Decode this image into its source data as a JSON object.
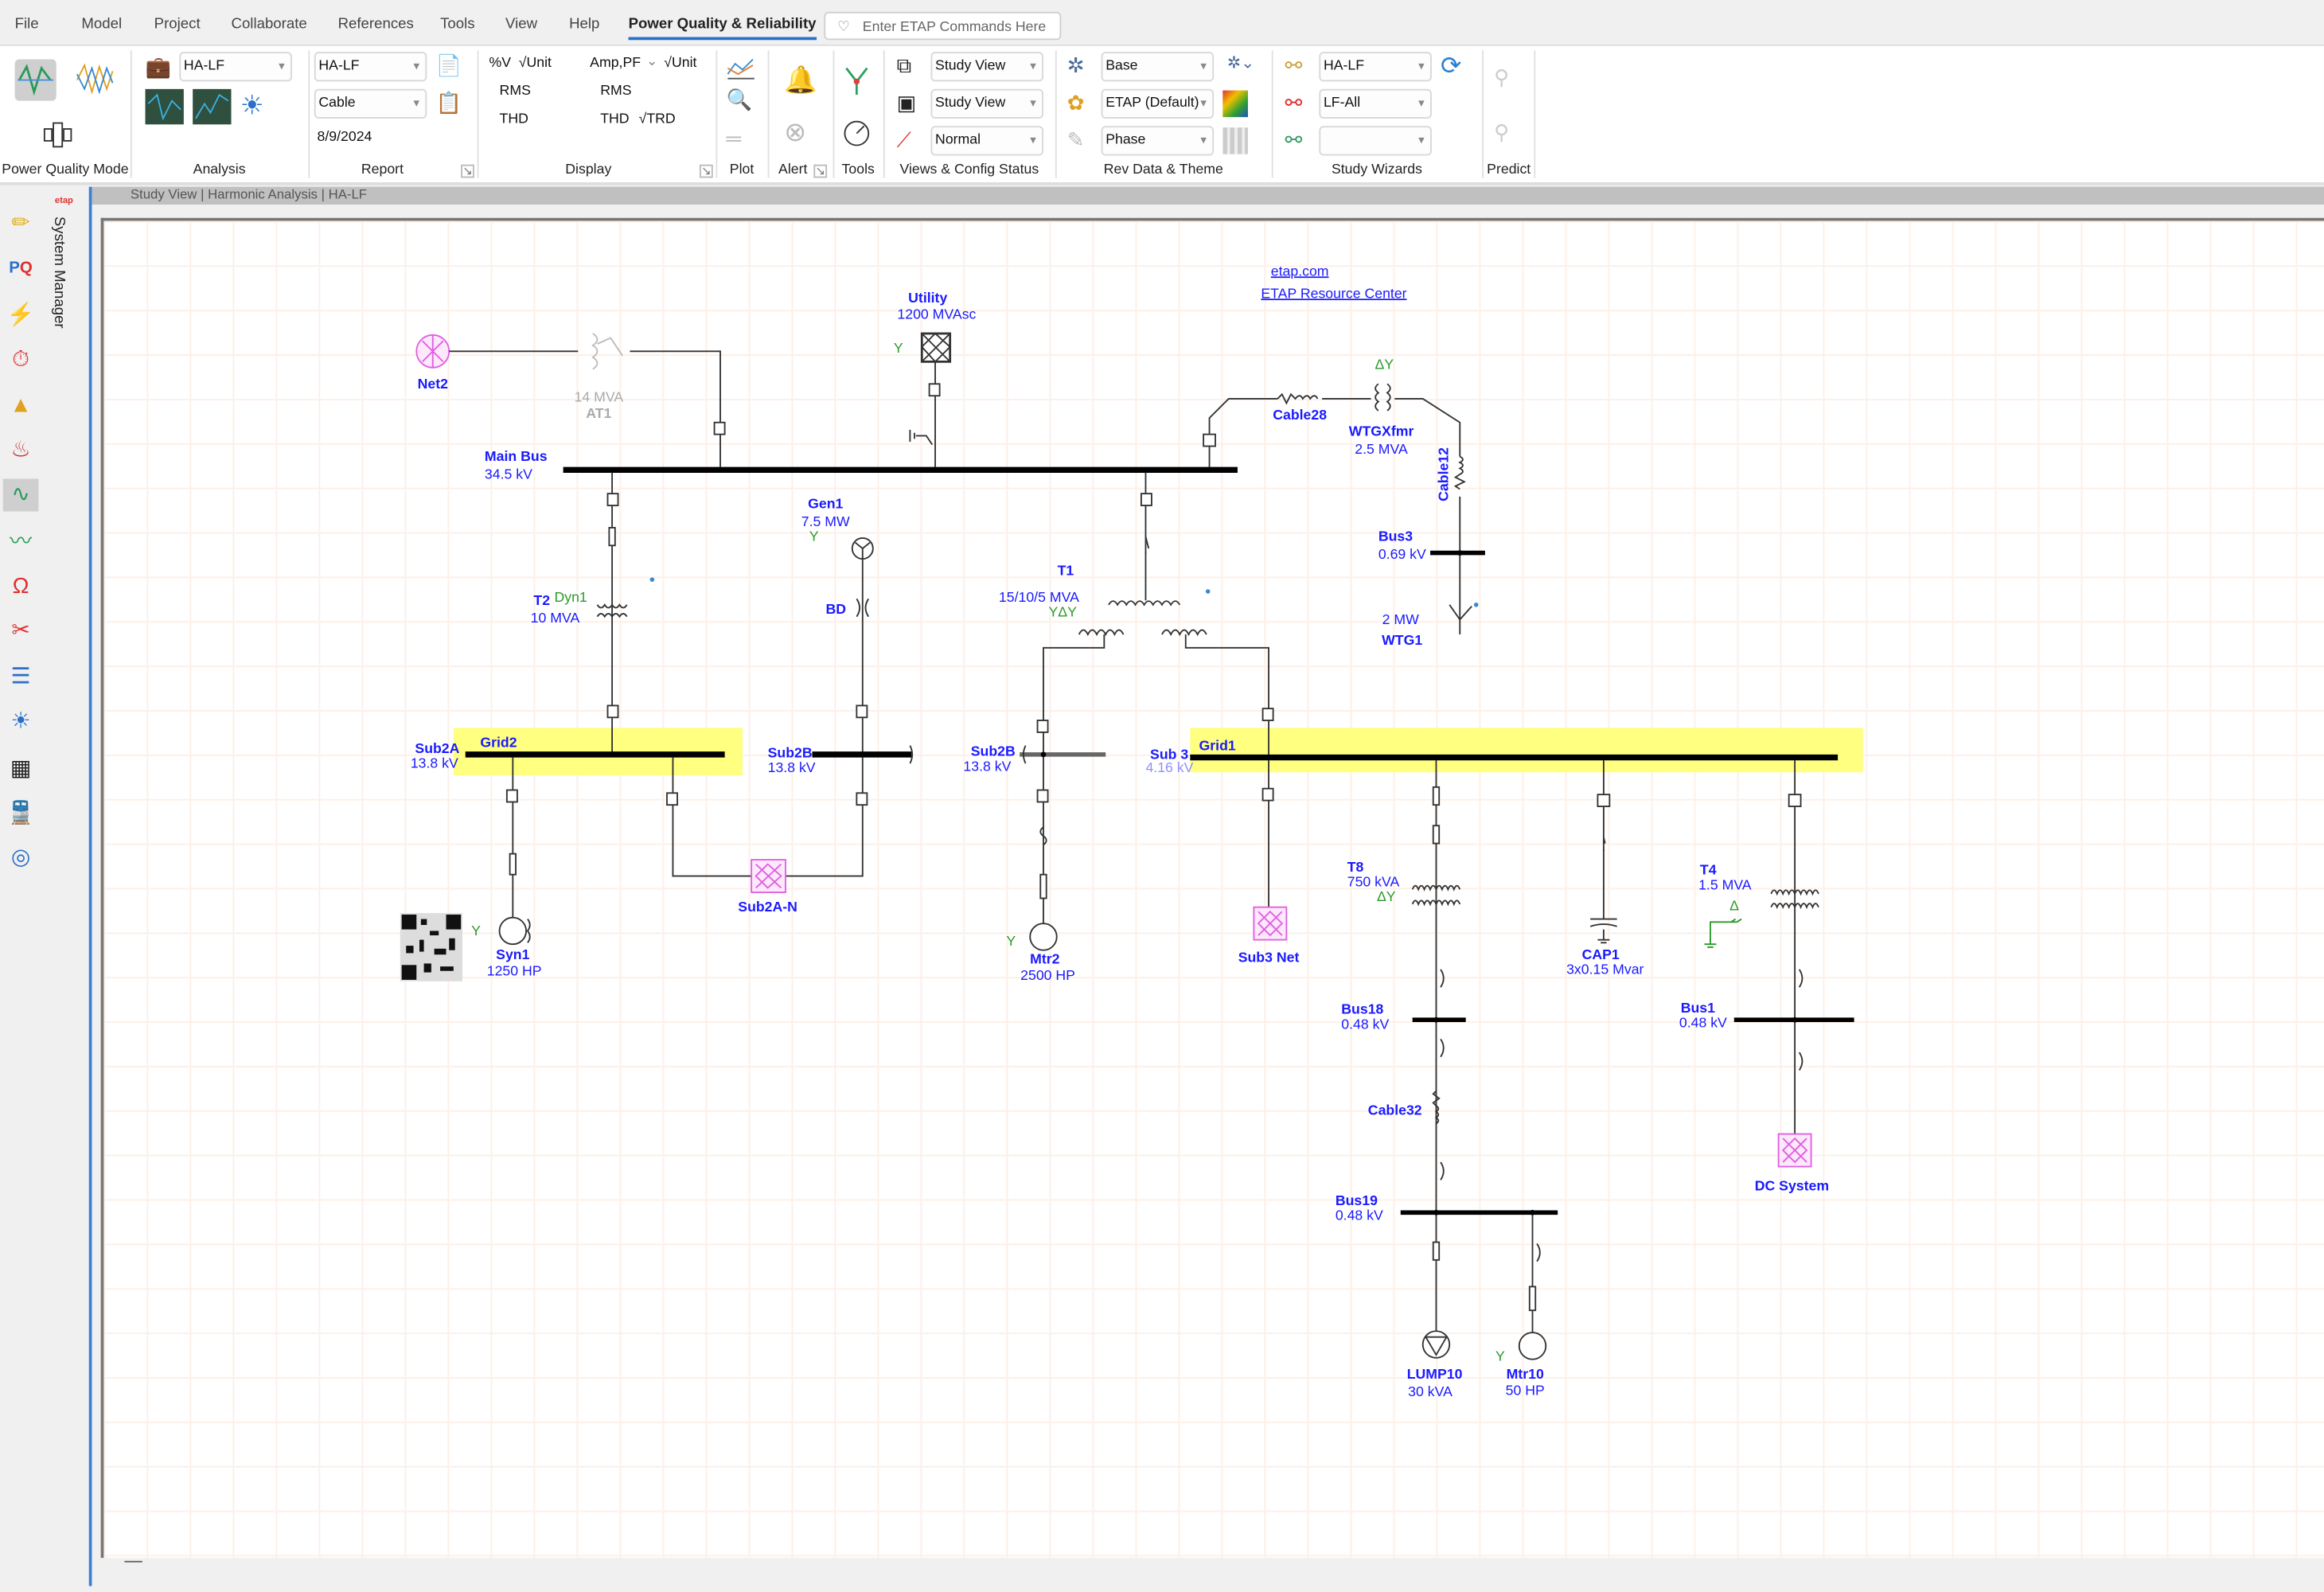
{
  "menu": {
    "items": [
      "File",
      "Model",
      "Project",
      "Collaborate",
      "References",
      "Tools",
      "View",
      "Help",
      "Power Quality & Reliability"
    ],
    "active": "Power Quality & Reliability"
  },
  "search": {
    "placeholder": "Enter ETAP Commands Here"
  },
  "ribbon": {
    "groups": {
      "pq_mode": "Power Quality Mode",
      "analysis": "Analysis",
      "report": "Report",
      "display": "Display",
      "plot": "Plot",
      "alert": "Alert",
      "tools": "Tools",
      "views": "Views & Config Status",
      "revdata": "Rev Data & Theme",
      "wizards": "Study Wizards",
      "predict": "Predict"
    },
    "analysis": {
      "study_case": "HA-LF"
    },
    "report": {
      "output": "HA-LF",
      "type": "Cable",
      "date": "8/9/2024"
    },
    "display": {
      "v": "%V",
      "v_unit": "√Unit",
      "rms1": "RMS",
      "thd1": "THD",
      "amp": "Amp,PF",
      "amp_unit": "√Unit",
      "rms2": "RMS",
      "thd2": "THD",
      "trd": "√TRD"
    },
    "views": {
      "presentation": "Study View",
      "config_view": "Study View",
      "config": "Normal"
    },
    "revdata": {
      "revision": "Base",
      "theme": "ETAP (Default)",
      "phase": "Phase"
    },
    "wizards": {
      "study": "HA-LF",
      "scenario": "LF-All",
      "third": ""
    }
  },
  "window": {
    "title": "Study View | Harmonic Analysis | HA-LF"
  },
  "side_tab": {
    "label": "System Manager"
  },
  "diagram": {
    "links": {
      "etap": "etap.com",
      "resource": "ETAP Resource Center"
    },
    "net2": "Net2",
    "at1": {
      "rating": "14 MVA",
      "name": "AT1"
    },
    "utility": {
      "name": "Utility",
      "rating": "1200 MVAsc"
    },
    "main_bus": {
      "name": "Main Bus",
      "kv": "34.5 kV"
    },
    "cable28": "Cable28",
    "wtgxfmr": {
      "conn": "ΔY",
      "name": "WTGXfmr",
      "rating": "2.5 MVA"
    },
    "cable12": "Cable12",
    "bus3": {
      "name": "Bus3",
      "kv": "0.69 kV"
    },
    "wtg1": {
      "rating": "2 MW",
      "name": "WTG1"
    },
    "gen1": {
      "name": "Gen1",
      "rating": "7.5 MW"
    },
    "t1": {
      "name": "T1",
      "rating": "15/10/5 MVA",
      "conn": "YΔY"
    },
    "t2": {
      "name": "T2",
      "conn": "Dyn1",
      "rating": "10 MVA"
    },
    "bd": "BD",
    "grid2": "Grid2",
    "sub2a": {
      "name": "Sub2A",
      "kv": "13.8 kV"
    },
    "sub2b": {
      "name": "Sub2B",
      "kv": "13.8 kV"
    },
    "sub2b_r": {
      "name": "Sub2B",
      "kv": "13.8 kV"
    },
    "sub3": {
      "name": "Sub 3",
      "kv": "4.16 kV"
    },
    "grid1": "Grid1",
    "sub2an": "Sub2A-N",
    "syn1": {
      "conn": "Y",
      "name": "Syn1",
      "rating": "1250 HP"
    },
    "mtr2": {
      "conn": "Y",
      "name": "Mtr2",
      "rating": "2500 HP"
    },
    "sub3net": "Sub3 Net",
    "t8": {
      "name": "T8",
      "rating": "750 kVA",
      "conn": "ΔY"
    },
    "cap1": {
      "name": "CAP1",
      "rating": "3x0.15 Mvar"
    },
    "t4": {
      "name": "T4",
      "rating": "1.5 MVA",
      "conn": "Δ"
    },
    "bus18": {
      "name": "Bus18",
      "kv": "0.48 kV"
    },
    "bus1": {
      "name": "Bus1",
      "kv": "0.48 kV"
    },
    "cable32": "Cable32",
    "dcsys": "DC System",
    "bus19": {
      "name": "Bus19",
      "kv": "0.48 kV"
    },
    "lump10": {
      "name": "LUMP10",
      "rating": "30 kVA"
    },
    "mtr10": {
      "conn": "Y",
      "name": "Mtr10",
      "rating": "50 HP"
    }
  },
  "colors": {
    "accent": "#2a6fc9",
    "element_label": "#1a1aff",
    "highlight": "#ffff80",
    "network": "#e060e0",
    "connection": "#2a9a2a"
  }
}
